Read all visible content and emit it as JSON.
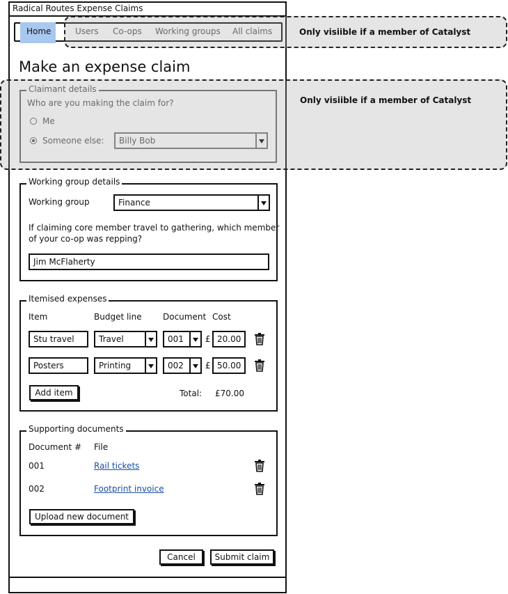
{
  "window": {
    "title": "Radical Routes Expense Claims"
  },
  "nav": {
    "items": [
      "Home",
      "Users",
      "Co-ops",
      "Working groups",
      "All claims"
    ]
  },
  "annotations": {
    "nav_note": "Only visiible if a member of Catalyst",
    "claimant_note": "Only visiible if a member of Catalyst"
  },
  "page": {
    "title": "Make an expense claim"
  },
  "claimant": {
    "legend": "Claimant details",
    "question": "Who are you making the claim for?",
    "option_me": "Me",
    "option_else": "Someone else:",
    "else_value": "Billy Bob"
  },
  "working_group": {
    "legend": "Working group details",
    "label": "Working group",
    "value": "Finance",
    "travel_question_line1": "If claiming core member travel to gathering, which member",
    "travel_question_line2": "of your co-op was repping?",
    "rep_value": "Jim McFlaherty"
  },
  "expenses": {
    "legend": "Itemised expenses",
    "headers": {
      "item": "Item",
      "budget": "Budget line",
      "document": "Document",
      "cost": "Cost"
    },
    "currency": "£",
    "rows": [
      {
        "item": "Stu travel",
        "budget": "Travel",
        "document": "001",
        "cost": "20.00"
      },
      {
        "item": "Posters",
        "budget": "Printing",
        "document": "002",
        "cost": "50.00"
      }
    ],
    "add_label": "Add item",
    "total_label": "Total:",
    "total_value": "£70.00"
  },
  "documents": {
    "legend": "Supporting documents",
    "headers": {
      "num": "Document #",
      "file": "File"
    },
    "rows": [
      {
        "num": "001",
        "file": "Rail tickets"
      },
      {
        "num": "002",
        "file": "Footprint invoice"
      }
    ],
    "upload_label": "Upload new document"
  },
  "actions": {
    "cancel": "Cancel",
    "submit": "Submit claim"
  },
  "colors": {
    "nav_active": "#a8c8f0",
    "link": "#1a4fa0",
    "overlay": "#a0a0a0"
  }
}
